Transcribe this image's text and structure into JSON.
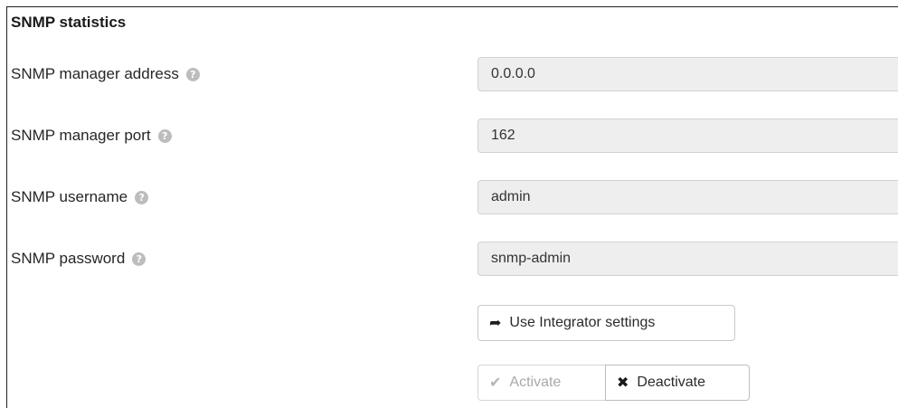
{
  "section": {
    "title": "SNMP statistics"
  },
  "fields": [
    {
      "label": "SNMP manager address",
      "value": "0.0.0.0",
      "help_icon": "question-circle-icon"
    },
    {
      "label": "SNMP manager port",
      "value": "162",
      "help_icon": "question-circle-icon"
    },
    {
      "label": "SNMP username",
      "value": "admin",
      "help_icon": "question-circle-icon"
    },
    {
      "label": "SNMP password",
      "value": "snmp-admin",
      "help_icon": "question-circle-icon"
    }
  ],
  "buttons": {
    "integrator": {
      "label": "Use Integrator settings",
      "icon": "share-arrow-icon"
    },
    "activate": {
      "label": "Activate",
      "icon": "check-icon",
      "disabled": true
    },
    "deactivate": {
      "label": "Deactivate",
      "icon": "times-icon"
    }
  },
  "help_glyph": "?",
  "colors": {
    "field_background": "#eeeeee",
    "help_icon": "#bdbdbd",
    "disabled_text": "#a9a9a9"
  }
}
